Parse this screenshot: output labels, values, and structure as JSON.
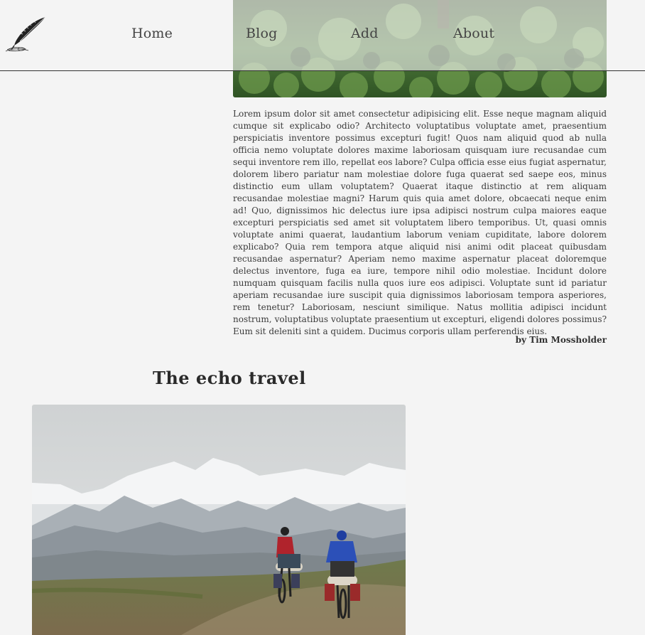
{
  "nav": {
    "home": "Home",
    "blog": "Blog",
    "add": "Add",
    "about": "About",
    "logo_icon": "quill-pen-icon"
  },
  "article": {
    "image_icon": "forest-photo",
    "body": "Lorem ipsum dolor sit amet consectetur adipisicing elit. Esse neque magnam aliquid cumque sit explicabo odio? Architecto voluptatibus voluptate amet, praesentium perspiciatis inventore possimus excepturi fugit! Quos nam aliquid quod ab nulla officia nemo voluptate dolores maxime laboriosam quisquam iure recusandae cum sequi inventore rem illo, repellat eos labore? Culpa officia esse eius fugiat aspernatur, dolorem libero pariatur nam molestiae dolore fuga quaerat sed saepe eos, minus distinctio eum ullam voluptatem? Quaerat itaque distinctio at rem aliquam recusandae molestiae magni? Harum quis quia amet dolore, obcaecati neque enim ad! Quo, dignissimos hic delectus iure ipsa adipisci nostrum culpa maiores eaque excepturi perspiciatis sed amet sit voluptatem libero temporibus. Ut, quasi omnis voluptate animi quaerat, laudantium laborum veniam cupiditate, labore dolorem explicabo? Quia rem tempora atque aliquid nisi animi odit placeat quibusdam recusandae aspernatur? Aperiam nemo maxime aspernatur placeat doloremque delectus inventore, fuga ea iure, tempore nihil odio molestiae. Incidunt dolore numquam quisquam facilis nulla quos iure eos adipisci. Voluptate sunt id pariatur aperiam recusandae iure suscipit quia dignissimos laboriosam tempora asperiores, rem tenetur? Laboriosam, nesciunt similique. Natus mollitia adipisci incidunt nostrum, voluptatibus voluptate praesentium ut excepturi, eligendi dolores possimus? Eum sit deleniti sint a quidem. Ducimus corporis ullam perferendis eius.",
    "author": "by Tim Mossholder"
  },
  "post": {
    "title": "The echo travel",
    "image_icon": "mountain-cyclists-photo"
  },
  "colors": {
    "background": "#f4f4f4",
    "text": "#333333",
    "nav_border": "#333333"
  }
}
